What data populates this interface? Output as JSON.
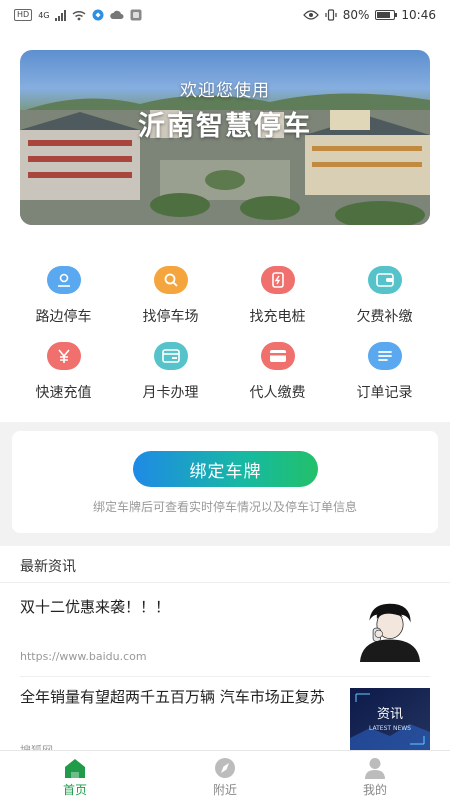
{
  "status_bar": {
    "left_chips": [
      "HD",
      "4G"
    ],
    "battery": "80%",
    "battery_level": 0.8,
    "time": "10:46"
  },
  "banner": {
    "welcome": "欢迎您使用",
    "title": "沂南智慧停车"
  },
  "services": [
    {
      "label": "路边停车",
      "icon": "location-pin-icon",
      "color": "#5aa8ef"
    },
    {
      "label": "找停车场",
      "icon": "search-icon",
      "color": "#f5a53d"
    },
    {
      "label": "找充电桩",
      "icon": "charger-icon",
      "color": "#f0706d"
    },
    {
      "label": "欠费补缴",
      "icon": "wallet-icon",
      "color": "#55c3c9"
    },
    {
      "label": "快速充值",
      "icon": "yen-icon",
      "color": "#f0706d"
    },
    {
      "label": "月卡办理",
      "icon": "card-icon",
      "color": "#55c3c9"
    },
    {
      "label": "代人缴费",
      "icon": "payment-card-icon",
      "color": "#f0706d"
    },
    {
      "label": "订单记录",
      "icon": "list-icon",
      "color": "#5aa8ef"
    }
  ],
  "bind_plate": {
    "button": "绑定车牌",
    "hint": "绑定车牌后可查看实时停车情况以及停车订单信息"
  },
  "news": {
    "header": "最新资讯",
    "items": [
      {
        "title": "双十二优惠来袭！！！",
        "source": "https://www.baidu.com"
      },
      {
        "title": "全年销量有望超两千五百万辆 汽车市场正复苏",
        "source": "搜狐网",
        "thumb_text": "资讯",
        "thumb_sub": "LATEST NEWS"
      }
    ]
  },
  "tabs": [
    {
      "label": "首页",
      "icon": "home-icon",
      "active": true
    },
    {
      "label": "附近",
      "icon": "compass-icon",
      "active": false
    },
    {
      "label": "我的",
      "icon": "user-icon",
      "active": false
    }
  ],
  "colors": {
    "accent_green": "#1f9b4a",
    "button_gradient_start": "#1f8ae6",
    "button_gradient_end": "#22c06a"
  }
}
